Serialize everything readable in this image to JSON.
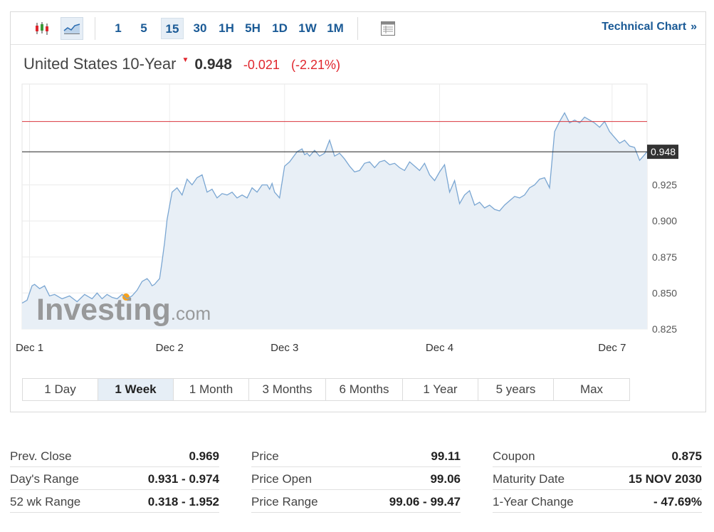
{
  "toolbar": {
    "candles_icon": "candlestick-icon",
    "area_icon": "area-chart-icon",
    "timeframes": [
      {
        "label": "1"
      },
      {
        "label": "5"
      },
      {
        "label": "15"
      },
      {
        "label": "30"
      },
      {
        "label": "1H"
      },
      {
        "label": "5H"
      },
      {
        "label": "1D"
      },
      {
        "label": "1W"
      },
      {
        "label": "1M"
      }
    ],
    "active_timeframe": "15",
    "table_icon": "table-icon",
    "technical_link": "Technical Chart",
    "technical_arrows": "»"
  },
  "quote": {
    "name": "United States 10-Year",
    "price": "0.948",
    "change": "-0.021",
    "change_pct": "(-2.21%)"
  },
  "chart_data": {
    "type": "area",
    "y_ticks": [
      "0.825",
      "0.850",
      "0.875",
      "0.900",
      "0.925"
    ],
    "ylim": [
      0.825,
      0.995
    ],
    "x_tick_labels": [
      "Dec 1",
      "Dec 2",
      "Dec 3",
      "Dec 4",
      "Dec 7"
    ],
    "x_tick_positions": [
      3,
      59,
      105,
      167,
      236
    ],
    "xlim": [
      0,
      250
    ],
    "last_price_label": "0.948",
    "last_price": 0.948,
    "prev_close": 0.969,
    "watermark_main": "Investing",
    "watermark_suffix": ".com",
    "colors": {
      "line": "#7aa6d2",
      "fill": "#e8eff6",
      "prev_close_line": "#d9363e",
      "price_line": "#222222",
      "price_tag": "#333333"
    },
    "series": [
      {
        "x": [
          0,
          2,
          4,
          5,
          7,
          9,
          11,
          13,
          16,
          19,
          22,
          25,
          28,
          30,
          32,
          34,
          36,
          38,
          40,
          42,
          44,
          46,
          48,
          50,
          51,
          52,
          53,
          54,
          55,
          56,
          57,
          58,
          60,
          62,
          64,
          66,
          68,
          70,
          72,
          74,
          76,
          78,
          80,
          82,
          84,
          86,
          88,
          90,
          92,
          94,
          96,
          98,
          99,
          100,
          101,
          102,
          103,
          105,
          107,
          110,
          112,
          113,
          114,
          115,
          117,
          119,
          121,
          123,
          125,
          127,
          129,
          131,
          133,
          135,
          137,
          139,
          141,
          143,
          145,
          147,
          149,
          151,
          153,
          155,
          157,
          159,
          161,
          163,
          165,
          167,
          169,
          171,
          173,
          175,
          177,
          179,
          181,
          183,
          185,
          187,
          189,
          191,
          193,
          195,
          197,
          199,
          201,
          203,
          205,
          207,
          209,
          211,
          213,
          215,
          217,
          219,
          221,
          223,
          225,
          227,
          229,
          231,
          233,
          235,
          237,
          239,
          241,
          243,
          245,
          247,
          249,
          250
        ],
        "y": [
          0.843,
          0.845,
          0.855,
          0.856,
          0.853,
          0.855,
          0.848,
          0.849,
          0.846,
          0.848,
          0.844,
          0.849,
          0.846,
          0.85,
          0.846,
          0.849,
          0.847,
          0.846,
          0.849,
          0.846,
          0.848,
          0.852,
          0.858,
          0.86,
          0.858,
          0.855,
          0.856,
          0.858,
          0.86,
          0.872,
          0.885,
          0.901,
          0.92,
          0.923,
          0.918,
          0.929,
          0.925,
          0.93,
          0.932,
          0.92,
          0.922,
          0.916,
          0.919,
          0.918,
          0.92,
          0.916,
          0.918,
          0.916,
          0.923,
          0.92,
          0.925,
          0.925,
          0.922,
          0.926,
          0.92,
          0.918,
          0.916,
          0.938,
          0.941,
          0.948,
          0.95,
          0.946,
          0.947,
          0.945,
          0.949,
          0.945,
          0.947,
          0.956,
          0.945,
          0.947,
          0.943,
          0.938,
          0.934,
          0.935,
          0.94,
          0.941,
          0.937,
          0.941,
          0.942,
          0.939,
          0.94,
          0.937,
          0.935,
          0.941,
          0.938,
          0.935,
          0.94,
          0.932,
          0.928,
          0.934,
          0.939,
          0.92,
          0.928,
          0.912,
          0.918,
          0.921,
          0.911,
          0.913,
          0.909,
          0.911,
          0.908,
          0.907,
          0.911,
          0.914,
          0.917,
          0.916,
          0.918,
          0.923,
          0.925,
          0.929,
          0.93,
          0.923,
          0.962,
          0.969,
          0.975,
          0.968,
          0.97,
          0.968,
          0.972,
          0.97,
          0.968,
          0.965,
          0.969,
          0.962,
          0.958,
          0.954,
          0.956,
          0.952,
          0.951,
          0.942,
          0.946,
          0.948
        ]
      }
    ]
  },
  "ranges": [
    {
      "label": "1 Day"
    },
    {
      "label": "1 Week"
    },
    {
      "label": "1 Month"
    },
    {
      "label": "3 Months"
    },
    {
      "label": "6 Months"
    },
    {
      "label": "1 Year"
    },
    {
      "label": "5 years"
    },
    {
      "label": "Max"
    }
  ],
  "active_range": "1 Week",
  "stats": [
    [
      {
        "label": "Prev. Close",
        "value": "0.969"
      },
      {
        "label": "Day's Range",
        "value": "0.931 - 0.974"
      },
      {
        "label": "52 wk Range",
        "value": "0.318 - 1.952"
      }
    ],
    [
      {
        "label": "Price",
        "value": "99.11"
      },
      {
        "label": "Price Open",
        "value": "99.06"
      },
      {
        "label": "Price Range",
        "value": "99.06 - 99.47"
      }
    ],
    [
      {
        "label": "Coupon",
        "value": "0.875"
      },
      {
        "label": "Maturity Date",
        "value": "15 NOV 2030"
      },
      {
        "label": "1-Year Change",
        "value": "- 47.69%"
      }
    ]
  ]
}
